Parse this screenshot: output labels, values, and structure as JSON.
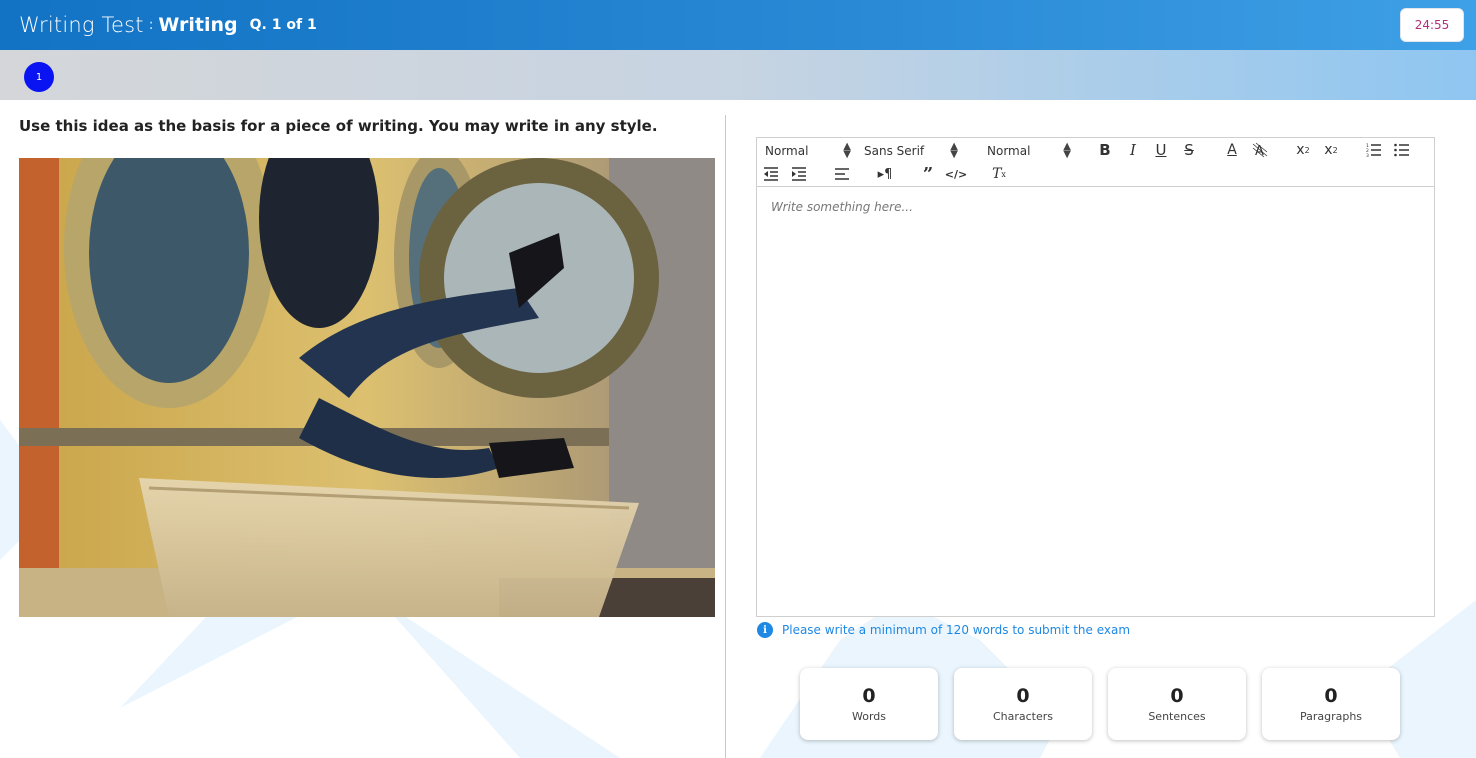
{
  "header": {
    "app_title": "Writing Test",
    "separator": ":",
    "section": "Writing",
    "question_counter": "Q. 1 of 1",
    "timer": "24:55"
  },
  "question_nav": {
    "items": [
      {
        "label": "1"
      }
    ]
  },
  "prompt": {
    "text": "Use this idea as the basis for a piece of writing. You may write in any style."
  },
  "editor": {
    "header_picker": "Normal",
    "font_picker": "Sans Serif",
    "size_picker": "Normal",
    "placeholder": "Write something here..."
  },
  "hint": {
    "text": "Please write a minimum of 120 words to submit the exam"
  },
  "stats": [
    {
      "value": "0",
      "label": "Words"
    },
    {
      "value": "0",
      "label": "Characters"
    },
    {
      "value": "0",
      "label": "Sentences"
    },
    {
      "value": "0",
      "label": "Paragraphs"
    }
  ],
  "colors": {
    "header_blue": "#1272c4",
    "accent_blue": "#1e88e5",
    "question_dot": "#0a14f2",
    "timer_text": "#b0307e"
  }
}
